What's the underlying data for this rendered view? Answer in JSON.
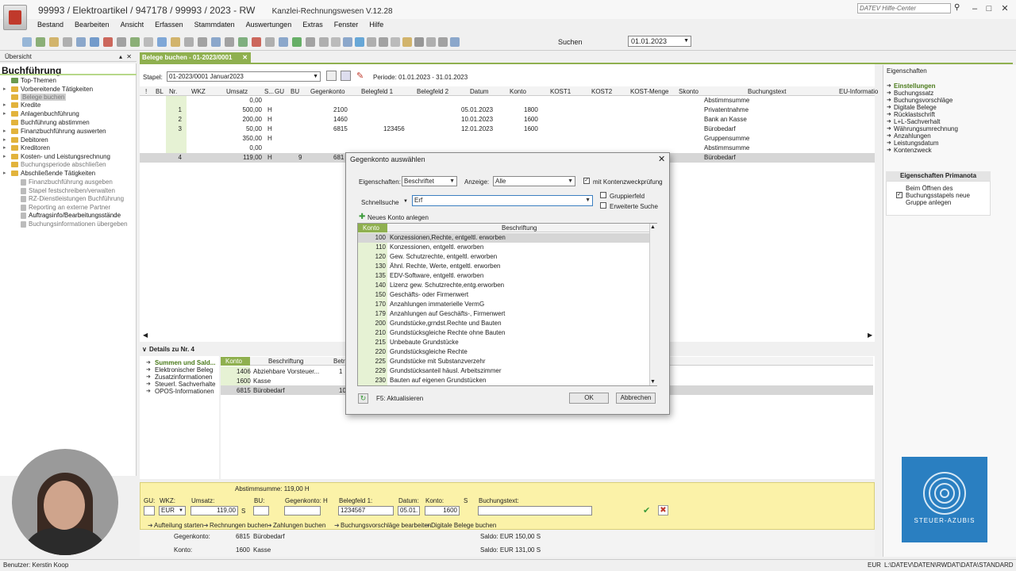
{
  "window": {
    "title": "99993 / Elektroartikel / 947178 / 99993 / 2023 - RW",
    "subtitle": "Kanzlei-Rechnungswesen V.12.28",
    "help_center": "DATEV Hilfe-Center"
  },
  "menu": [
    "Bestand",
    "Bearbeiten",
    "Ansicht",
    "Erfassen",
    "Stammdaten",
    "Auswertungen",
    "Extras",
    "Fenster",
    "Hilfe"
  ],
  "toolbar": {
    "search_label": "Suchen",
    "date": "01.01.2023"
  },
  "left": {
    "header": "Übersicht",
    "title": "Buchführung",
    "items": [
      {
        "label": "Top-Themen",
        "level": 0
      },
      {
        "label": "Vorbereitende Tätigkeiten",
        "level": 0
      },
      {
        "label": "Belege buchen",
        "level": 0
      },
      {
        "label": "Kredite",
        "level": 0
      },
      {
        "label": "Anlagenbuchführung",
        "level": 0
      },
      {
        "label": "Buchführung abstimmen",
        "level": 0
      },
      {
        "label": "Finanzbuchführung auswerten",
        "level": 0
      },
      {
        "label": "Debitoren",
        "level": 0
      },
      {
        "label": "Kreditoren",
        "level": 0
      },
      {
        "label": "Kosten- und Leistungsrechnung",
        "level": 0
      },
      {
        "label": "Buchungsperiode abschließen",
        "level": 0
      },
      {
        "label": "Abschließende Tätigkeiten",
        "level": 0
      },
      {
        "label": "Finanzbuchführung ausgeben",
        "level": 1
      },
      {
        "label": "Stapel festschreiben/verwalten",
        "level": 1
      },
      {
        "label": "RZ-Dienstleistungen Buchführung",
        "level": 1
      },
      {
        "label": "Reporting an externe Partner",
        "level": 1
      },
      {
        "label": "Auftragsinfo/Bearbeitungsstände",
        "level": 1
      },
      {
        "label": "Buchungsinformationen übergeben",
        "level": 1
      }
    ]
  },
  "main": {
    "tab": "Belege buchen - 01-2023/0001",
    "stapel_label": "Stapel:",
    "stapel_value": "01-2023/0001  Januar2023",
    "periode": "Periode:        01.01.2023 - 31.01.2023",
    "columns": [
      "!",
      "BL",
      "Nr.",
      "WKZ",
      "Umsatz",
      "S...",
      "GU",
      "BU",
      "Gegenkonto",
      "Belegfeld 1",
      "Belegfeld 2",
      "Datum",
      "Konto",
      "KOST1",
      "KOST2",
      "KOST-Menge",
      "Skonto",
      "Buchungstext",
      "EU-Informatio"
    ],
    "rows": [
      {
        "nr": "",
        "umsatz": "0,00",
        "sh": "",
        "bu": "",
        "gegenkonto": "",
        "belegfeld1": "",
        "datum": "",
        "konto": "",
        "text": "Abstimmsumme"
      },
      {
        "nr": "1",
        "umsatz": "500,00",
        "sh": "H",
        "bu": "",
        "gegenkonto": "2100",
        "belegfeld1": "",
        "datum": "05.01.2023",
        "konto": "1800",
        "text": "Privatentnahme"
      },
      {
        "nr": "2",
        "umsatz": "200,00",
        "sh": "H",
        "bu": "",
        "gegenkonto": "1460",
        "belegfeld1": "",
        "datum": "10.01.2023",
        "konto": "1600",
        "text": "Bank an Kasse"
      },
      {
        "nr": "3",
        "umsatz": "50,00",
        "sh": "H",
        "bu": "",
        "gegenkonto": "6815",
        "belegfeld1": "123456",
        "datum": "12.01.2023",
        "konto": "1600",
        "text": "Bürobedarf"
      },
      {
        "nr": "",
        "umsatz": "350,00",
        "sh": "H",
        "bu": "",
        "gegenkonto": "",
        "belegfeld1": "",
        "datum": "",
        "konto": "",
        "text": "Gruppensumme"
      },
      {
        "nr": "",
        "umsatz": "0,00",
        "sh": "",
        "bu": "",
        "gegenkonto": "",
        "belegfeld1": "",
        "datum": "",
        "konto": "",
        "text": "Abstimmsumme"
      },
      {
        "nr": "4",
        "umsatz": "119,00",
        "sh": "H",
        "bu": "9",
        "gegenkonto": "681",
        "belegfeld1": "",
        "datum": "",
        "konto": "",
        "text": "Bürobedarf"
      }
    ]
  },
  "details": {
    "title": "Details zu Nr. 4",
    "items": [
      "Summen und Sald...",
      "Elektronischer Beleg",
      "Zusatzinformationen",
      "Steuerl. Sachverhalte",
      "OPOS-Informationen"
    ],
    "columns": [
      "Konto",
      "Beschriftung",
      "Betra"
    ],
    "rows": [
      {
        "konto": "1406",
        "text": "Abziehbare Vorsteuer...",
        "betrag": "1"
      },
      {
        "konto": "1600",
        "text": "Kasse",
        "betrag": ""
      },
      {
        "konto": "6815",
        "text": "Bürobedarf",
        "betrag": "10"
      }
    ]
  },
  "entry": {
    "abstimmsumme": "Abstimmsumme: 119,00 H",
    "labels": {
      "gu": "GU:",
      "wkz": "WKZ:",
      "umsatz": "Umsatz:",
      "bu": "BU:",
      "gegenkonto": "Gegenkonto:",
      "h": "H",
      "belegfeld1": "Belegfeld 1:",
      "datum": "Datum:",
      "konto": "Konto:",
      "s": "S",
      "buchungstext": "Buchungstext:"
    },
    "wkz": "EUR",
    "umsatz": "119,00",
    "umsatz_sh": "S",
    "belegfeld1": "1234567",
    "datum": "05.01.",
    "konto": "1600",
    "links": [
      "Aufteilung starten",
      "Rechnungen buchen",
      "Zahlungen buchen",
      "Buchungsvorschläge bearbeiten",
      "Digitale Belege buchen"
    ],
    "gegenkonto_label": "Gegenkonto:",
    "gegenkonto_nr": "6815",
    "gegenkonto_name": "Bürobedarf",
    "konto_label": "Konto:",
    "konto_nr": "1600",
    "konto_name": "Kasse",
    "saldo1": "Saldo:  EUR                    150,00  S",
    "saldo2": "Saldo:  EUR                    131,00  S"
  },
  "properties": {
    "header": "Eigenschaften",
    "items": [
      "Einstellungen",
      "Buchungssatz",
      "Buchungsvorschläge",
      "Digitale Belege",
      "Rücklastschrift",
      "L+L-Sachverhalt",
      "Währungsumrechnung",
      "Anzahlungen",
      "Leistungsdatum",
      "Kontenzweck"
    ],
    "primanota_title": "Eigenschaften Primanota",
    "primanota_option": "Beim Öffnen des Buchungsstapels neue Gruppe anlegen"
  },
  "dialog": {
    "title": "Gegenkonto auswählen",
    "eigenschaften_label": "Eigenschaften:",
    "eigenschaften_value": "Beschriftet",
    "anzeige_label": "Anzeige:",
    "anzeige_value": "Alle",
    "mit_kontenzweck": "mit Kontenzweckprüfung",
    "schnellsuche_label": "Schnellsuche",
    "schnellsuche_value": "Erf",
    "gruppierfeld": "Gruppierfeld",
    "erweiterte_suche": "Erweiterte Suche",
    "neues_konto": "Neues Konto anlegen",
    "col_konto": "Konto",
    "col_beschriftung": "Beschriftung",
    "accounts": [
      {
        "konto": "100",
        "text": "Konzessionen,Rechte, entgeltl. erworben"
      },
      {
        "konto": "110",
        "text": "Konzessionen, entgeltl. erworben"
      },
      {
        "konto": "120",
        "text": "Gew. Schutzrechte, entgeltl. erworben"
      },
      {
        "konto": "130",
        "text": "Ähnl. Rechte, Werte, entgeltl. erworben"
      },
      {
        "konto": "135",
        "text": "EDV-Software, entgeltl. erworben"
      },
      {
        "konto": "140",
        "text": "Lizenz gew. Schutzrechte,entg.erworben"
      },
      {
        "konto": "150",
        "text": "Geschäfts- oder Firmenwert"
      },
      {
        "konto": "170",
        "text": "Anzahlungen immaterielle VermG"
      },
      {
        "konto": "179",
        "text": "Anzahlungen auf Geschäfts-, Firmenwert"
      },
      {
        "konto": "200",
        "text": "Grundstücke,grndst.Rechte und Bauten"
      },
      {
        "konto": "210",
        "text": "Grundstücksgleiche Rechte ohne Bauten"
      },
      {
        "konto": "215",
        "text": "Unbebaute Grundstücke"
      },
      {
        "konto": "220",
        "text": "Grundstücksgleiche Rechte"
      },
      {
        "konto": "225",
        "text": "Grundstücke mit Substanzverzehr"
      },
      {
        "konto": "229",
        "text": "Grundstücksanteil häusl. Arbeitszimmer"
      },
      {
        "konto": "230",
        "text": "Bauten auf eigenen Grundstücken"
      }
    ],
    "f5_label": "F5: Aktualisieren",
    "ok": "OK",
    "cancel": "Abbrechen"
  },
  "status": {
    "user": "Benutzer: Kerstin Koop",
    "currency": "EUR",
    "path": "L:\\DATEV\\DATEN\\RWDAT\\DATA\\STANDARD"
  },
  "logo_text": "STEUER-AZUBIS",
  "colors": {
    "accent_green": "#8fb04f",
    "entry_yellow": "#fbf2a8",
    "logo_blue": "#2a7fc1"
  }
}
